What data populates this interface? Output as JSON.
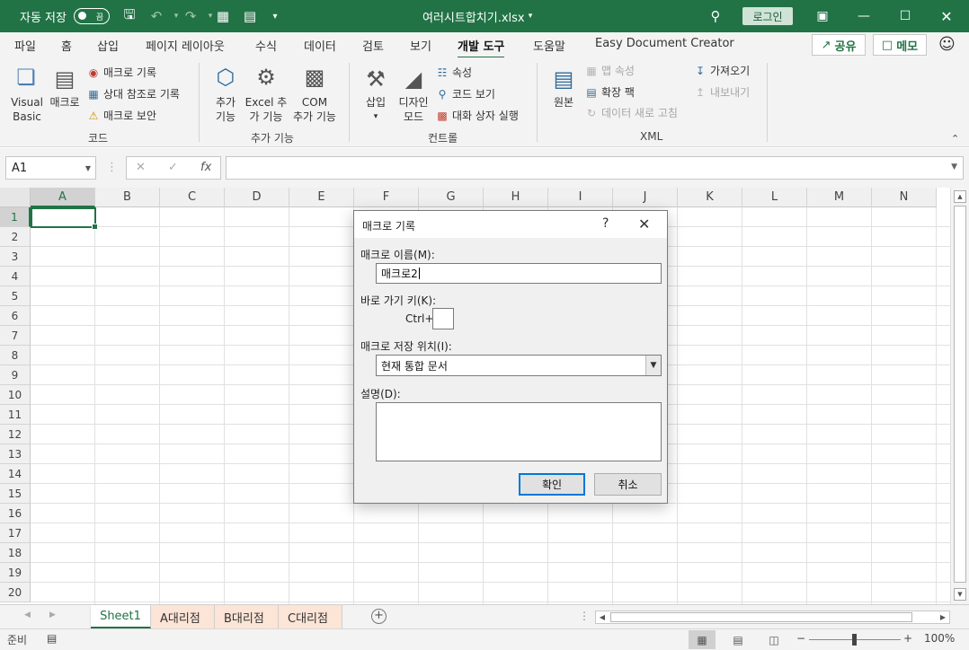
{
  "titlebar": {
    "autosave_label": "자동 저장",
    "autosave_state": "끔",
    "filename": "여러시트합치기.xlsx",
    "login": "로그인"
  },
  "ribbon_tabs": [
    "파일",
    "홈",
    "삽입",
    "페이지 레이아웃",
    "수식",
    "데이터",
    "검토",
    "보기",
    "개발 도구",
    "도움말",
    "Easy Document Creator"
  ],
  "active_tab": "개발 도구",
  "share_label": "공유",
  "memo_label": "메모",
  "ribbon": {
    "code": {
      "group": "코드",
      "vb_line1": "Visual",
      "vb_line2": "Basic",
      "macro": "매크로",
      "record_macro": "매크로 기록",
      "relative_ref": "상대 참조로 기록",
      "macro_security": "매크로 보안"
    },
    "addins": {
      "group": "추가 기능",
      "addin_line1": "추가",
      "addin_line2": "기능",
      "excel_line1": "Excel 추",
      "excel_line2": "가 기능",
      "com_line1": "COM",
      "com_line2": "추가 기능"
    },
    "controls": {
      "group": "컨트롤",
      "insert": "삽입",
      "design_line1": "디자인",
      "design_line2": "모드",
      "properties": "속성",
      "view_code": "코드 보기",
      "run_dialog": "대화 상자 실행"
    },
    "xml": {
      "group": "XML",
      "source": "원본",
      "map_properties": "맵 속성",
      "expansion_packs": "확장 팩",
      "refresh_data": "데이터 새로 고침",
      "import": "가져오기",
      "export": "내보내기"
    }
  },
  "formula_bar": {
    "name_box": "A1",
    "fx": "fx",
    "formula": ""
  },
  "columns": [
    "A",
    "B",
    "C",
    "D",
    "E",
    "F",
    "G",
    "H",
    "I",
    "J",
    "K",
    "L",
    "M",
    "N"
  ],
  "rows": [
    "1",
    "2",
    "3",
    "4",
    "5",
    "6",
    "7",
    "8",
    "9",
    "10",
    "11",
    "12",
    "13",
    "14",
    "15",
    "16",
    "17",
    "18",
    "19",
    "20"
  ],
  "sheets": [
    "Sheet1",
    "A대리점",
    "B대리점",
    "C대리점"
  ],
  "active_sheet": "Sheet1",
  "status": {
    "ready": "준비",
    "zoom": "100%"
  },
  "dialog": {
    "title": "매크로 기록",
    "help": "?",
    "macro_name_label": "매크로 이름(M):",
    "macro_name_value": "매크로2",
    "shortcut_label": "바로 가기 키(K):",
    "ctrl_label": "Ctrl+",
    "shortcut_value": "",
    "store_label": "매크로 저장 위치(I):",
    "store_value": "현재 통합 문서",
    "description_label": "설명(D):",
    "description_value": "",
    "ok": "확인",
    "cancel": "취소"
  },
  "colors": {
    "brand": "#217346",
    "orange_tab": "#fce4d6"
  }
}
